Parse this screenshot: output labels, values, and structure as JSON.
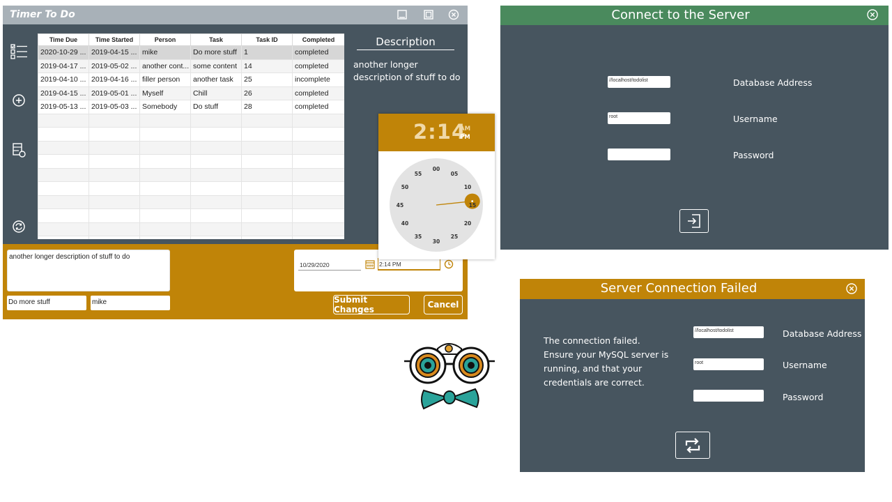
{
  "colors": {
    "orange": "#c08408",
    "slate": "#47555f",
    "green": "#4a8a5d",
    "titlebar_gray": "#a8b1b8"
  },
  "main_window": {
    "title": "Timer To Do",
    "window_icons": [
      "minimize-icon",
      "maximize-icon",
      "close-icon"
    ],
    "sidebar_icons": [
      "task-list-icon",
      "add-circle-icon",
      "database-settings-icon",
      "refresh-circle-icon"
    ],
    "table": {
      "columns": [
        "Time Due",
        "Time Started",
        "Person",
        "Task",
        "Task ID",
        "Completed"
      ],
      "rows": [
        [
          "2020-10-29 ...",
          "2019-04-15 ...",
          "mike",
          "Do more stuff",
          "1",
          "completed"
        ],
        [
          "2019-04-17 ...",
          "2019-05-02 ...",
          "another cont...",
          "some content",
          "14",
          "completed"
        ],
        [
          "2019-04-10 ...",
          "2019-04-16 ...",
          "filler person",
          "another task",
          "25",
          "incomplete"
        ],
        [
          "2019-04-15 ...",
          "2019-05-01 ...",
          "Myself",
          "Chill",
          "26",
          "completed"
        ],
        [
          "2019-05-13 ...",
          "2019-05-03 ...",
          "Somebody",
          "Do stuff",
          "28",
          "completed"
        ]
      ],
      "selected_row": 0,
      "empty_rows": 10
    },
    "description": {
      "heading": "Description",
      "text": "another longer description of stuff to do"
    },
    "editor": {
      "description_value": "another longer description of stuff to do",
      "task_value": "Do more stuff",
      "person_value": "mike",
      "date_value": "10/29/2020",
      "time_value": "2:14 PM",
      "submit_label": "Submit Changes",
      "cancel_label": "Cancel"
    }
  },
  "time_picker": {
    "hour_minute": "2:14",
    "am": "AM",
    "pm": "PM",
    "minute_labels": [
      "00",
      "05",
      "10",
      "15",
      "20",
      "25",
      "30",
      "35",
      "40",
      "45",
      "50",
      "55"
    ],
    "selected_minute": 14
  },
  "connect_window": {
    "title": "Connect to the Server",
    "address_value": "//localhost/todolist",
    "username_value": "root",
    "password_value": "",
    "address_label": "Database Address",
    "username_label": "Username",
    "password_label": "Password",
    "button_icon": "sign-in-icon"
  },
  "failed_window": {
    "title": "Server Connection Failed",
    "message": "The connection failed. Ensure your MySQL server is running, and that your credentials are correct.",
    "address_value": "//localhost/todolist",
    "username_value": "root",
    "password_value": "",
    "address_label": "Database Address",
    "username_label": "Username",
    "password_label": "Password",
    "button_icon": "retry-icon"
  },
  "logo": {
    "icon": "owl-glasses-bowtie-logo"
  }
}
